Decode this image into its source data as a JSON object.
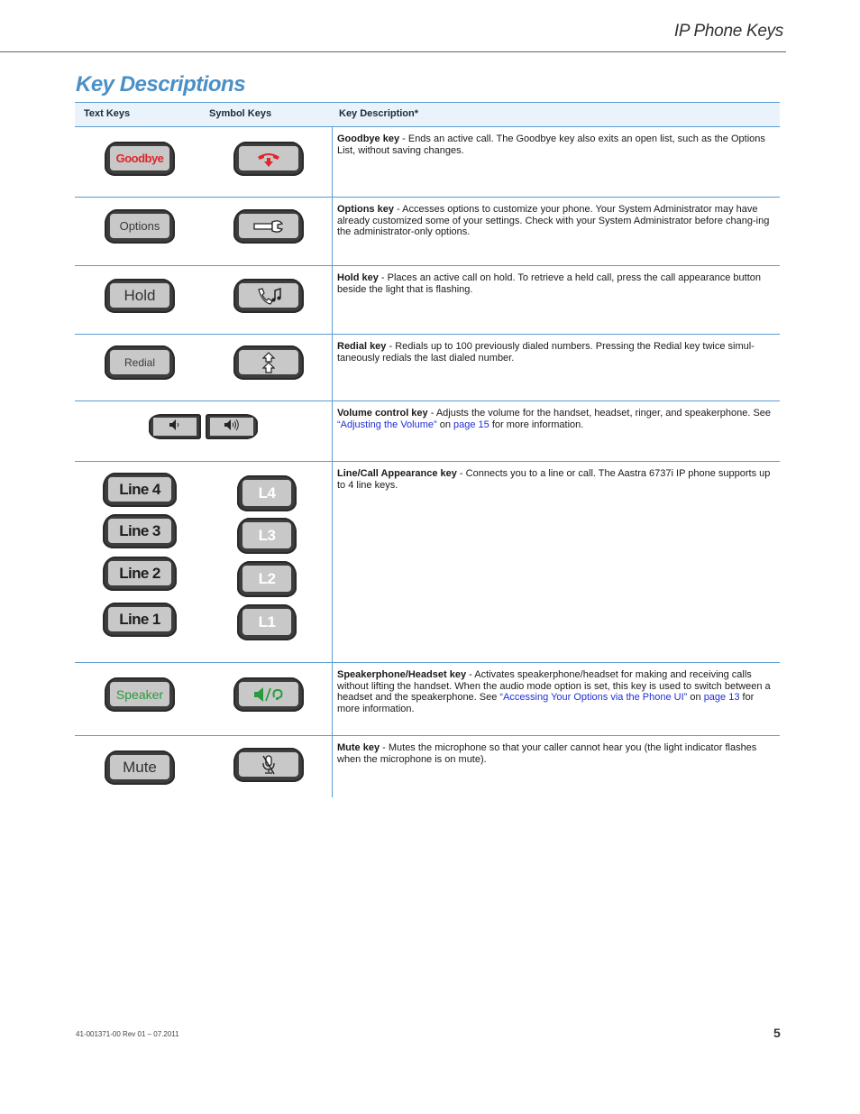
{
  "header": {
    "section_title": "IP Phone Keys"
  },
  "page_title": "Key Descriptions",
  "table": {
    "columns": [
      "Text Keys",
      "Symbol Keys",
      "Key Description*"
    ],
    "rows": [
      {
        "text_key": "Goodbye",
        "symbol_icon": "hang-up-handset-icon",
        "name": "Goodbye key",
        "description": " - Ends an active call. The Goodbye key also exits an open list, such as the Options List, without saving changes."
      },
      {
        "text_key": "Options",
        "symbol_icon": "wrench-icon",
        "name": "Options key",
        "description": " - Accesses options to customize your phone. Your System Administrator may have already customized some of your settings. Check with your System Administrator before chang-ing the administrator-only options."
      },
      {
        "text_key": "Hold",
        "symbol_icon": "handset-music-note-icon",
        "name": "Hold key",
        "description": " - Places an active call on hold. To retrieve a held call, press the call appearance button beside the light that is flashing."
      },
      {
        "text_key": "Redial",
        "symbol_icon": "double-up-arrow-icon",
        "name": "Redial key",
        "description": " - Redials up to 100 previously dialed numbers. Pressing the Redial key twice simul-taneously redials the last dialed number."
      },
      {
        "symbol_icons": [
          "volume-down-icon",
          "volume-up-icon"
        ],
        "name": "Volume control key",
        "description_pre": " - Adjusts the volume for the handset, headset, ringer, and speakerphone. See ",
        "link1": "“Adjusting the Volume”",
        "mid": " on ",
        "link2": "page 15",
        "description_post": " for more information."
      },
      {
        "text_keys": [
          "Line 4",
          "Line 3",
          "Line 2",
          "Line 1"
        ],
        "symbol_keys": [
          "L4",
          "L3",
          "L2",
          "L1"
        ],
        "name": "Line/Call Appearance key",
        "description": " - Connects you to a line or call. The Aastra 6737i IP phone supports up to 4 line keys."
      },
      {
        "text_key": "Speaker",
        "symbol_icon": "speaker-headset-icon",
        "name": "Speakerphone/Headset key",
        "description_pre": " - Activates speakerphone/headset for making and receiving calls without lifting the handset. When the audio mode option is set, this key is used to switch between a headset and the speakerphone. See ",
        "link1": "“Accessing Your Options via the Phone UI”",
        "mid": " on ",
        "link2": "page 13",
        "description_post": " for more information."
      },
      {
        "text_key": "Mute",
        "symbol_icon": "muted-microphone-icon",
        "name": "Mute key",
        "description": " - Mutes the microphone so that your caller cannot hear you (the light indicator flashes when the microphone is on mute)."
      }
    ]
  },
  "colors": {
    "accent_blue": "#4a90c6",
    "rule_blue": "#5b9bd1",
    "link_blue": "#1f2fd6",
    "goodbye_red": "#e0262b",
    "speaker_green": "#2b9a3e"
  },
  "footer": {
    "doc_id": "41-001371-00 Rev 01 – 07.2011",
    "page_number": "5"
  }
}
